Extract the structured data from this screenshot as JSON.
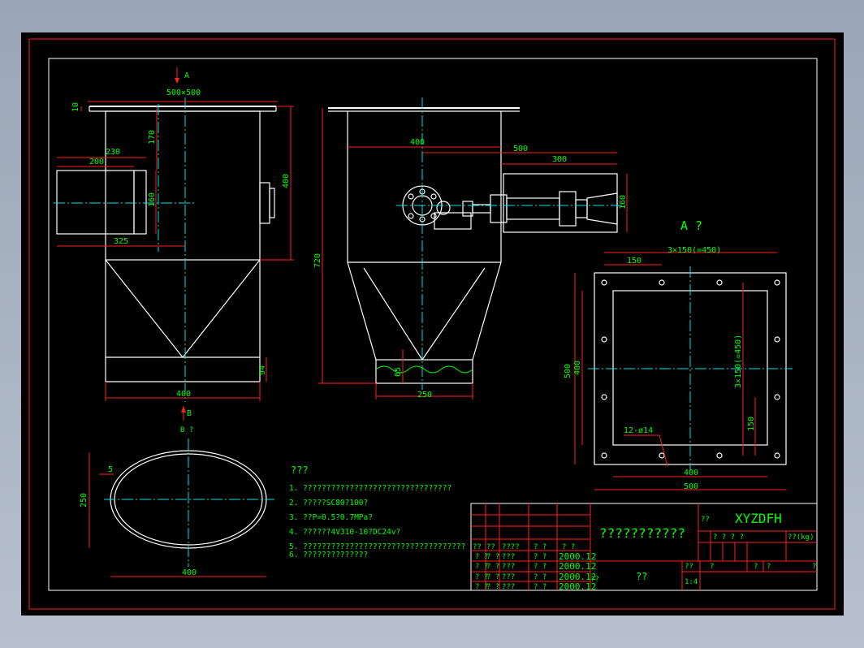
{
  "colors": {
    "sheet": "#000000",
    "frame": "#ff2020",
    "geometry": "#ffffff",
    "dims": "#00ff00",
    "center": "#00e0e0"
  },
  "views": {
    "view_a_label": "A",
    "view_a_title": "A ?",
    "view_b_label": "B",
    "view_b_title": "B ?"
  },
  "dims": {
    "d_500x500": "500×500",
    "d_10": "10",
    "d_170": "170",
    "d_230": "230",
    "d_200": "200",
    "d_160a": "160",
    "d_325": "325",
    "d_400side": "400",
    "d_94": "94",
    "d_400bot": "400",
    "d_400front": "400",
    "d_500front": "500",
    "d_300": "300",
    "d_160b": "160",
    "d_720": "720",
    "d_65": "65",
    "d_250": "250",
    "d_3x150": "3×150(=450)",
    "d_150top": "150",
    "d_500v": "500",
    "d_400v": "400",
    "d_3x150v": "3×150(=450)",
    "d_150v": "150",
    "d_12holes": "12-ø14",
    "d_400flange": "400",
    "d_500flange": "500",
    "d_5": "5",
    "d_250ell": "250",
    "d_400ell": "400"
  },
  "notes": {
    "title": "???",
    "items": [
      "1. ????????????????????????????????",
      "2. ?????SC80?100?",
      "3. ??P=0.5?0.7MPa?",
      "4. ??????4V310-10?DC24v?",
      "5. ???????????????????????????????????",
      "6. ??????????????"
    ]
  },
  "title_block": {
    "name": "???????????",
    "code": "XYZDFH",
    "mark": "??",
    "material_hdr": "? ? ? ?",
    "weight_hdr": "??(kg)",
    "rows_left": [
      [
        "??",
        "??",
        "????",
        "? ?",
        "? ?"
      ],
      [
        "? ?",
        "? ?",
        "???",
        "? ?",
        "2000.12"
      ],
      [
        "? ?",
        "? ?",
        "???",
        "? ?",
        "2000.12"
      ],
      [
        "? ?",
        "? ?",
        "???",
        "? ?",
        "2000.12"
      ],
      [
        "? ?",
        "? ?",
        "???",
        "? ?",
        "2000.12"
      ]
    ],
    "sheet_mark": "??",
    "scale_label": "??",
    "scale_value": "1:4",
    "q1": "?",
    "q2": "?",
    "q3": "?",
    "q4": "?",
    "small_q": "??"
  }
}
